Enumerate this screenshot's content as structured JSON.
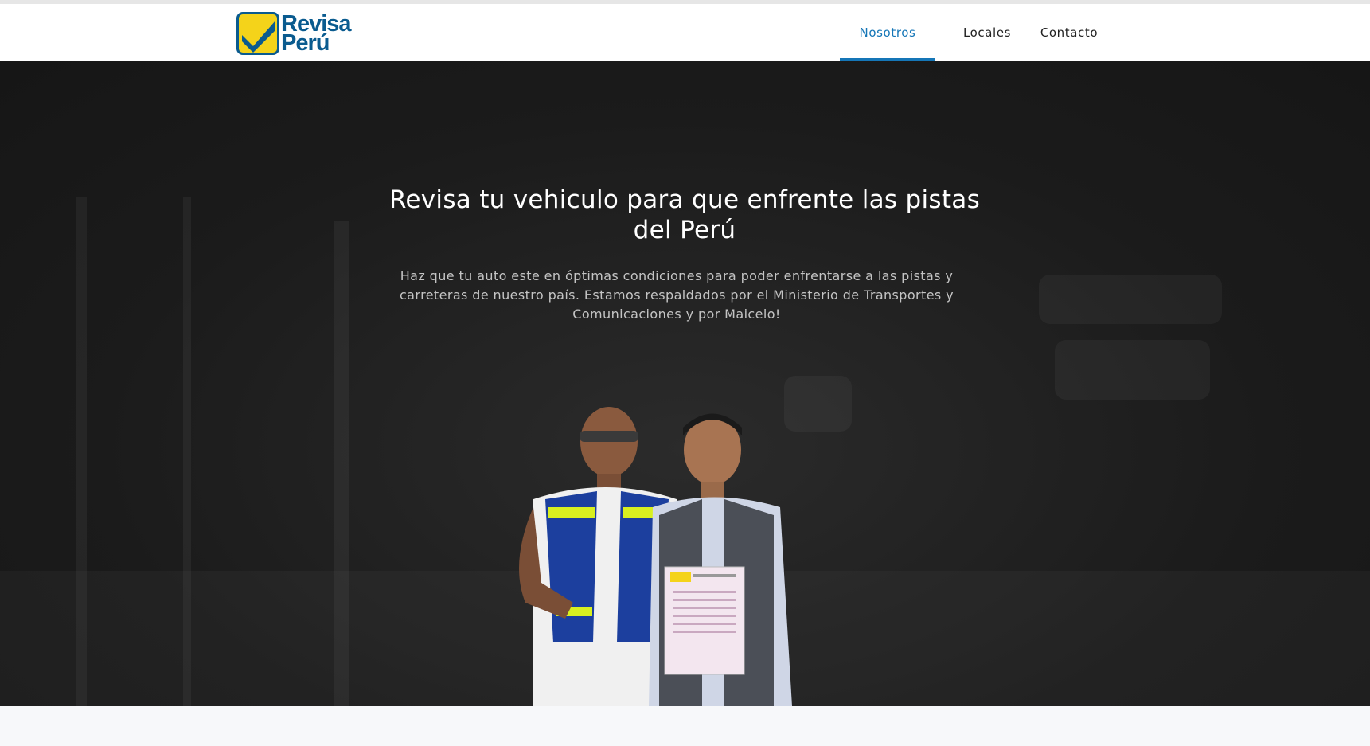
{
  "brand": {
    "name_line1": "Revisa",
    "name_line2": "Perú",
    "logo_icon": "checkmark-logo-icon",
    "colors": {
      "blue": "#0a5b8f",
      "yellow": "#f4d31a"
    }
  },
  "nav": {
    "items": [
      {
        "label": "Nosotros",
        "active": true
      },
      {
        "label": "Locales",
        "active": false
      },
      {
        "label": "Contacto",
        "active": false
      }
    ],
    "active_color": "#1576b7"
  },
  "hero": {
    "title": "Revisa tu vehiculo para que enfrente las pistas del Perú",
    "text": "Haz que tu auto este en óptimas condiciones para poder enfrentarse a las pistas y carreteras de nuestro país. Estamos respaldados por el Ministerio de Transportes y Comunicaciones y por Maicelo!",
    "image": "two-men-with-inspection-certificate-photo"
  }
}
